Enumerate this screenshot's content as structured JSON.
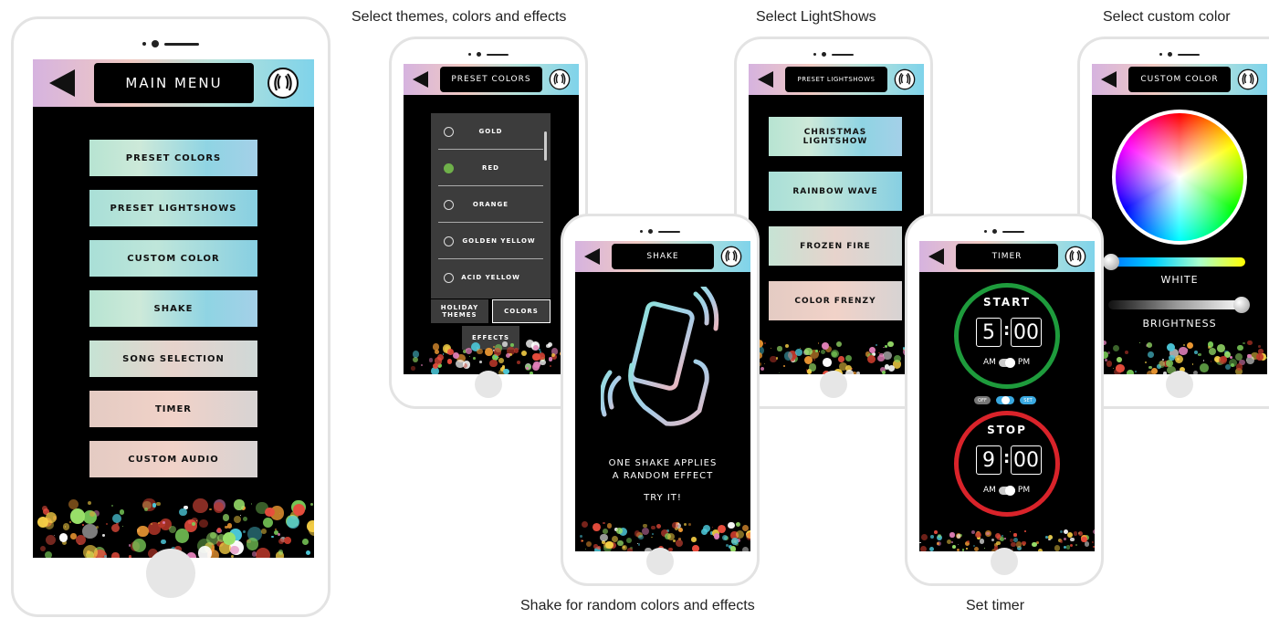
{
  "captions": {
    "themes": "Select themes, colors and effects",
    "lightshows": "Select LightShows",
    "custom_color": "Select custom color",
    "shake": "Shake for random colors and effects",
    "timer": "Set timer"
  },
  "main_menu": {
    "title": "MAIN MENU",
    "items": [
      {
        "label": "PRESET COLORS"
      },
      {
        "label": "PRESET LIGHTSHOWS"
      },
      {
        "label": "CUSTOM COLOR"
      },
      {
        "label": "SHAKE"
      },
      {
        "label": "SONG SELECTION"
      },
      {
        "label": "TIMER"
      },
      {
        "label": "CUSTOM AUDIO"
      }
    ]
  },
  "preset_colors": {
    "title": "PRESET COLORS",
    "options": [
      {
        "label": "GOLD",
        "selected": false
      },
      {
        "label": "RED",
        "selected": true
      },
      {
        "label": "ORANGE",
        "selected": false
      },
      {
        "label": "GOLDEN YELLOW",
        "selected": false
      },
      {
        "label": "ACID YELLOW",
        "selected": false
      }
    ],
    "tabs": {
      "holiday_line1": "HOLIDAY",
      "holiday_line2": "THEMES",
      "colors": "COLORS",
      "effects": "EFFECTS"
    }
  },
  "shake": {
    "title": "SHAKE",
    "line1": "ONE SHAKE APPLIES",
    "line2": "A RANDOM EFFECT",
    "try": "TRY IT!"
  },
  "lightshows": {
    "title": "PRESET LIGHTSHOWS",
    "items": [
      {
        "label": "CHRISTMAS LIGHTSHOW"
      },
      {
        "label": "RAINBOW WAVE"
      },
      {
        "label": "FROZEN FIRE"
      },
      {
        "label": "COLOR FRENZY"
      }
    ]
  },
  "timer": {
    "title": "TIMER",
    "start": {
      "label": "START",
      "hour": "5",
      "minutes": "00",
      "am": "AM",
      "pm": "PM"
    },
    "stop": {
      "label": "STOP",
      "hour": "9",
      "minutes": "00",
      "am": "AM",
      "pm": "PM"
    },
    "pills": {
      "off": "OFF",
      "set": "SET"
    },
    "colors": {
      "start_ring": "#1e9b3c",
      "stop_ring": "#d9232a"
    }
  },
  "custom_color": {
    "title": "CUSTOM COLOR",
    "white_label": "WHITE",
    "brightness_label": "BRIGHTNESS"
  },
  "icons": {
    "back": "back-arrow-icon",
    "logo": "laurel-logo-icon",
    "home": "home-button"
  }
}
